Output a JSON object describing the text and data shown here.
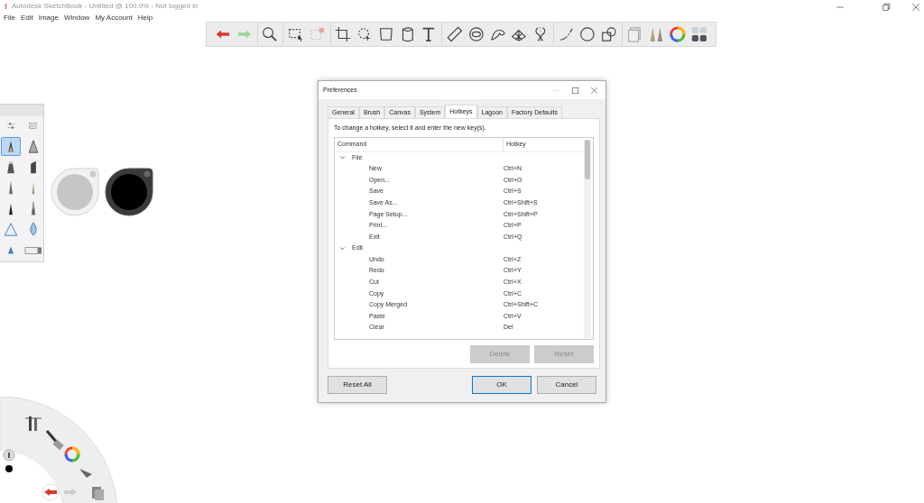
{
  "window": {
    "title": "Autodesk SketchBook - Untitled @ 100.0% - Not logged in"
  },
  "menu": [
    "File",
    "Edit",
    "Image",
    "Window",
    "My Account",
    "Help"
  ],
  "brush_palette": {
    "brushes": [
      {
        "selected": true
      },
      {
        "selected": false
      },
      {
        "selected": false
      },
      {
        "selected": false
      },
      {
        "selected": false
      },
      {
        "selected": false
      },
      {
        "selected": false
      },
      {
        "selected": false
      },
      {
        "selected": false
      },
      {
        "selected": false
      },
      {
        "selected": false
      },
      {
        "selected": false
      }
    ]
  },
  "color_pucks": [
    {
      "color": "#c6c6c6"
    },
    {
      "color": "#000000"
    }
  ],
  "dialog": {
    "title": "Preferences",
    "tabs": [
      {
        "label": "General",
        "selected": false
      },
      {
        "label": "Brush",
        "selected": false
      },
      {
        "label": "Canvas",
        "selected": false
      },
      {
        "label": "System",
        "selected": false
      },
      {
        "label": "Hotkeys",
        "selected": true
      },
      {
        "label": "Lagoon",
        "selected": false
      },
      {
        "label": "Factory Defaults",
        "selected": false
      }
    ],
    "instruction": "To change a hotkey, select it and enter the new key(s).",
    "columns": [
      "Command",
      "Hotkey"
    ],
    "groups": [
      {
        "label": "File",
        "expanded": true,
        "children": [
          {
            "command": "New",
            "hotkey": "Ctrl+N"
          },
          {
            "command": "Open...",
            "hotkey": "Ctrl+O"
          },
          {
            "command": "Save",
            "hotkey": "Ctrl+S"
          },
          {
            "command": "Save As...",
            "hotkey": "Ctrl+Shift+S"
          },
          {
            "command": "Page Setup...",
            "hotkey": "Ctrl+Shift+P"
          },
          {
            "command": "Print...",
            "hotkey": "Ctrl+P"
          },
          {
            "command": "Exit",
            "hotkey": "Ctrl+Q"
          }
        ]
      },
      {
        "label": "Edit",
        "expanded": true,
        "children": [
          {
            "command": "Undo",
            "hotkey": "Ctrl+Z"
          },
          {
            "command": "Redo",
            "hotkey": "Ctrl+Y"
          },
          {
            "command": "Cut",
            "hotkey": "Ctrl+X"
          },
          {
            "command": "Copy",
            "hotkey": "Ctrl+C"
          },
          {
            "command": "Copy Merged",
            "hotkey": "Ctrl+Shift+C"
          },
          {
            "command": "Paste",
            "hotkey": "Ctrl+V"
          },
          {
            "command": "Clear",
            "hotkey": "Del"
          }
        ]
      }
    ],
    "row_buttons": [
      {
        "label": "Delete",
        "disabled": true
      },
      {
        "label": "Reset",
        "disabled": true
      }
    ],
    "footer_buttons": [
      {
        "label": "Reset All",
        "kind": "secondary"
      },
      {
        "label": "OK",
        "kind": "default"
      },
      {
        "label": "Cancel",
        "kind": "secondary"
      }
    ]
  }
}
